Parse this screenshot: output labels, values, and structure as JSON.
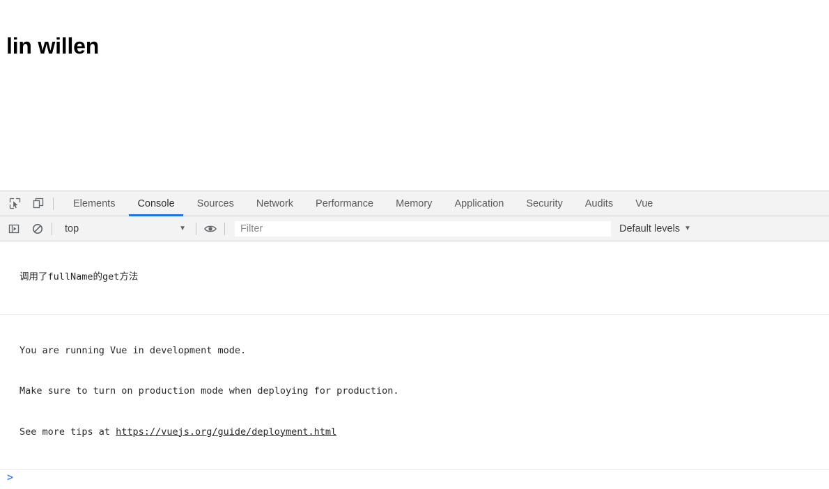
{
  "page": {
    "heading": "lin willen"
  },
  "devtools": {
    "icons": {
      "inspect": "inspect-cursor-icon",
      "device": "device-toolbar-icon",
      "sidebar_toggle": "console-sidebar-toggle-icon",
      "clear_console": "clear-console-icon",
      "eye": "live-expression-eye-icon"
    },
    "tabs": [
      {
        "label": "Elements",
        "active": false
      },
      {
        "label": "Console",
        "active": true
      },
      {
        "label": "Sources",
        "active": false
      },
      {
        "label": "Network",
        "active": false
      },
      {
        "label": "Performance",
        "active": false
      },
      {
        "label": "Memory",
        "active": false
      },
      {
        "label": "Application",
        "active": false
      },
      {
        "label": "Security",
        "active": false
      },
      {
        "label": "Audits",
        "active": false
      },
      {
        "label": "Vue",
        "active": false
      }
    ],
    "toolbar": {
      "context": "top",
      "context_caret": "▼",
      "filter_placeholder": "Filter",
      "filter_value": "",
      "levels_label": "Default levels",
      "levels_caret": "▼"
    },
    "console": {
      "messages": [
        {
          "lines": [
            {
              "text": "调用了fullName的get方法"
            }
          ]
        },
        {
          "lines": [
            {
              "text": "You are running Vue in development mode."
            },
            {
              "text": "Make sure to turn on production mode when deploying for production."
            },
            {
              "text": "See more tips at ",
              "link": "https://vuejs.org/guide/deployment.html"
            }
          ]
        }
      ],
      "prompt_caret": ">",
      "prompt_value": ""
    },
    "colors": {
      "accent": "#1a73e8",
      "prompt": "#4285f4",
      "toolbar_bg": "#f3f3f3",
      "border": "#cdcdcd"
    }
  }
}
